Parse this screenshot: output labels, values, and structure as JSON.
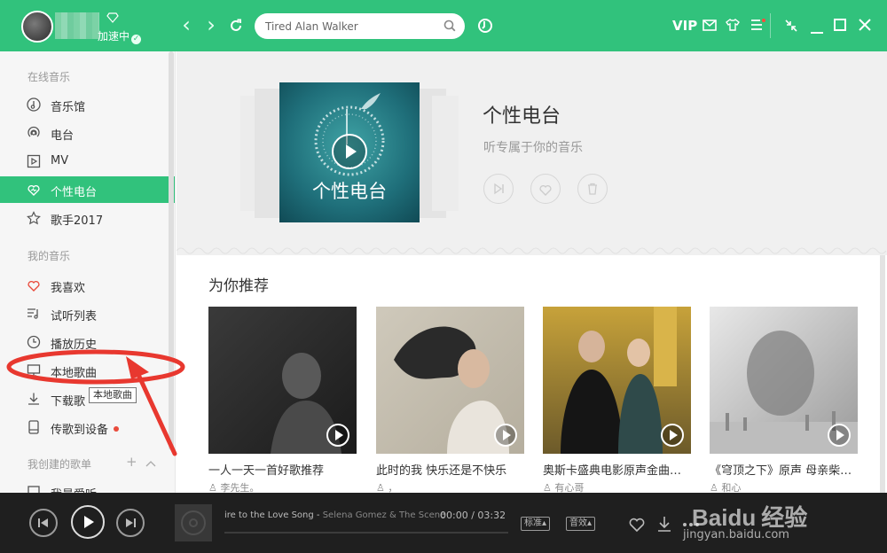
{
  "user": {
    "status_text": "加速中"
  },
  "search": {
    "value": "Tired Alan Walker"
  },
  "topbar": {
    "vip_label": "VIP"
  },
  "sidebar": {
    "online_section": "在线音乐",
    "online_items": [
      {
        "label": "音乐馆",
        "icon": "music-hall-icon"
      },
      {
        "label": "电台",
        "icon": "radio-icon"
      },
      {
        "label": "MV",
        "icon": "mv-icon"
      },
      {
        "label": "个性电台",
        "icon": "heart-radio-icon",
        "active": true
      },
      {
        "label": "歌手2017",
        "icon": "star-icon"
      }
    ],
    "my_section": "我的音乐",
    "my_items": [
      {
        "label": "我喜欢",
        "icon": "heart-icon"
      },
      {
        "label": "试听列表",
        "icon": "playlist-icon"
      },
      {
        "label": "播放历史",
        "icon": "clock-icon"
      },
      {
        "label": "本地歌曲",
        "icon": "computer-icon"
      },
      {
        "label": "下载歌",
        "icon": "download-icon"
      },
      {
        "label": "传歌到设备",
        "icon": "device-icon"
      }
    ],
    "tooltip": "本地歌曲",
    "created_section": "我创建的歌单",
    "created_items": [
      {
        "label": "我最爱听"
      }
    ]
  },
  "radio": {
    "cover_text": "个性电台",
    "title": "个性电台",
    "subtitle": "听专属于你的音乐"
  },
  "recommend": {
    "title": "为你推荐",
    "cards": [
      {
        "title": "一人一天一首好歌推荐",
        "user": "李先生。"
      },
      {
        "title": "此时的我 快乐还是不快乐",
        "user": "，"
      },
      {
        "title": "奥斯卡盛典电影原声金曲…",
        "user": "有心哥"
      },
      {
        "title": "《穹顶之下》原声 母亲柴…",
        "user": "和心"
      }
    ]
  },
  "player": {
    "song": "ire to the Love Song",
    "artist": "Selena Gomez & The Scene",
    "current_time": "00:00",
    "total_time": "03:32",
    "quality_label": "标准",
    "effect_label": "音效",
    "progress": 0
  },
  "watermark": {
    "brand": "Baidu",
    "brand_cn": "经验",
    "url": "jingyan.baidu.com"
  },
  "colors": {
    "accent": "#31c27c",
    "player_bg": "#1f1f1f",
    "annotation": "#e8382f"
  }
}
